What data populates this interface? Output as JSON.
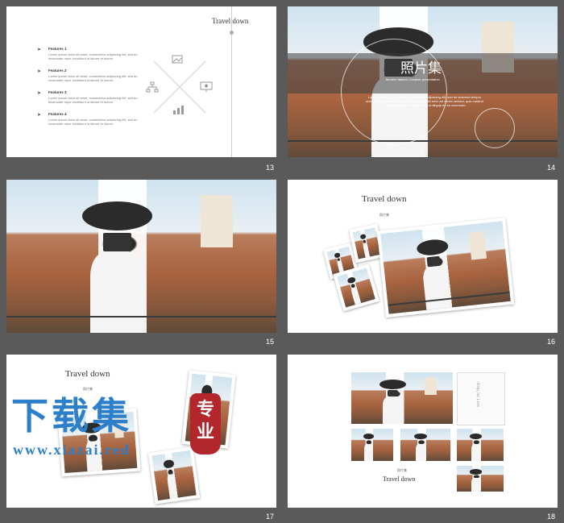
{
  "slides": [
    {
      "number": "13",
      "title": "Travel down",
      "features": [
        {
          "title": "Features 1",
          "text": "Lorem ipsum dolor sit amet, consectetur adipiscing elit, sed do eiusmodte mpor incididunt ut labore et dolore."
        },
        {
          "title": "Features 2",
          "text": "Lorem ipsum dolor sit amet, consectetur adipiscing elit, sed do eiusmodte mpor incididunt ut labore et dolore."
        },
        {
          "title": "Features 3",
          "text": "Lorem ipsum dolor sit amet, consectetur adipiscing elit, sed do eiusmodte mpor incididunt ut labore et dolore."
        },
        {
          "title": "Features 4",
          "text": "Lorem ipsum dolor sit amet, consectetur adipiscing elit, sed do eiusmodte mpor incididunt ut labore et dolore."
        }
      ],
      "icons": [
        "image-icon",
        "org-chart-icon",
        "presentation-icon",
        "bar-chart-icon"
      ]
    },
    {
      "number": "14",
      "title": "照片集",
      "subtitle": "Modern fashion Creative presentation",
      "body": "Lorem ipsum dolor sit amet, consectetur adipiscing elit, sed do eiusmod tempor incididunt ut labore et dolore magna aliqua Ut enim ad minim veniam, quis nostrud exercitation ullamco laboris nisi ut aliquip ex ea commodo."
    },
    {
      "number": "15"
    },
    {
      "number": "16",
      "title": "Travel down",
      "caption": "照片集"
    },
    {
      "number": "17",
      "title": "Travel down",
      "caption": "照片集"
    },
    {
      "number": "18",
      "caption": "照片集",
      "title": "Travel down",
      "side_text": "Help, let, Love"
    }
  ],
  "watermark": {
    "logo_text": "下载集",
    "seal_text": "专业",
    "url": "www.xiazai.red"
  },
  "colors": {
    "accent": "#2d7fc9",
    "seal": "#b3262b",
    "background": "#5a5a5a"
  }
}
